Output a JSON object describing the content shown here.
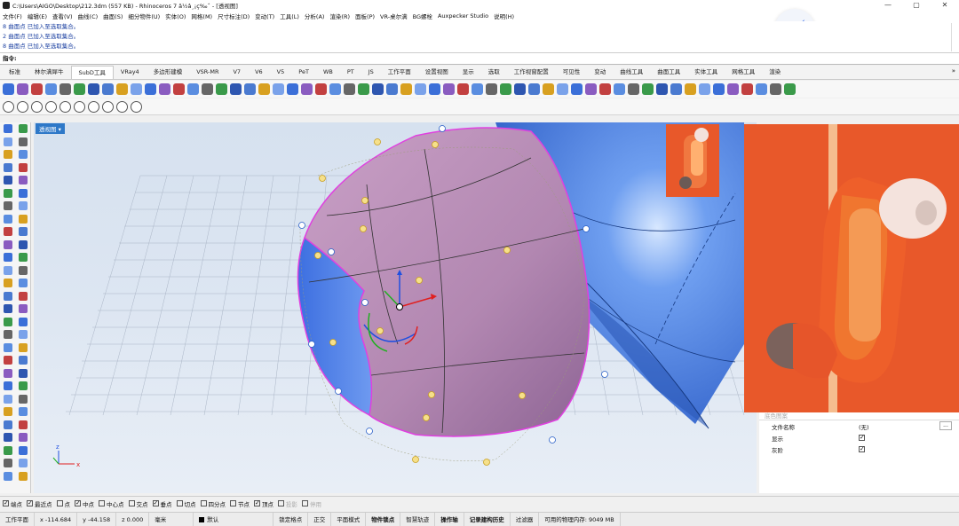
{
  "window": {
    "title": "C:\\Users\\AIGO\\Desktop\\212.3dm (557 KB) - Rhinoceros 7 â½â¸¡ç‰ˆ - [透视图]",
    "controls": [
      "—",
      "▢",
      "✕"
    ]
  },
  "menu": [
    "文件(F)",
    "编辑(E)",
    "查看(V)",
    "曲线(C)",
    "曲面(S)",
    "细分物件(U)",
    "实体(O)",
    "网格(M)",
    "尺寸标注(D)",
    "变动(T)",
    "工具(L)",
    "分析(A)",
    "渲染(R)",
    "面板(P)",
    "VR-桌尔满",
    "BG螺栓",
    "Auxpecker Studio",
    "说明(H)"
  ],
  "command_history": [
    "8 曲面点 已加入至选取集合。",
    "2 曲面点 已加入至选取集合。",
    "8 曲面点 已加入至选取集合。"
  ],
  "command_prompt": "指令:",
  "tabs": [
    "标准",
    "林尔满犀牛",
    "SubD工具",
    "VRay4",
    "多边形建模",
    "VSR-MR",
    "V7",
    "V6",
    "V5",
    "PeT",
    "WB",
    "PT",
    "JS",
    "工作平面",
    "设置视图",
    "显示",
    "选取",
    "工作视窗配置",
    "可见性",
    "变动",
    "曲线工具",
    "曲面工具",
    "实体工具",
    "网格工具",
    "渲染"
  ],
  "active_tab": "SubD工具",
  "viewport": {
    "label": "透视图",
    "axes": {
      "z": "z",
      "x": "x",
      "y": "y"
    }
  },
  "properties": {
    "rows": [
      {
        "label": "文件名称",
        "value": "(无)",
        "type": "text"
      },
      {
        "label": "显示",
        "value": "",
        "type": "check",
        "checked": true
      },
      {
        "label": "灰阶",
        "value": "",
        "type": "check",
        "checked": true
      }
    ],
    "more_button": "..."
  },
  "osnaps": [
    {
      "label": "端点",
      "checked": true
    },
    {
      "label": "最近点",
      "checked": true
    },
    {
      "label": "点",
      "checked": false
    },
    {
      "label": "中点",
      "checked": true
    },
    {
      "label": "中心点",
      "checked": false
    },
    {
      "label": "交点",
      "checked": false
    },
    {
      "label": "垂点",
      "checked": true
    },
    {
      "label": "切点",
      "checked": false
    },
    {
      "label": "四分点",
      "checked": false
    },
    {
      "label": "节点",
      "checked": false
    },
    {
      "label": "顶点",
      "checked": true
    },
    {
      "label": "投影",
      "checked": false,
      "dim": true
    },
    {
      "label": "停用",
      "checked": false,
      "dim": true
    }
  ],
  "status": {
    "cplane": "工作平面",
    "x": "x -114.684",
    "y": "y -44.158",
    "z": "z 0.000",
    "units": "毫米",
    "layer": "默认",
    "toggles": [
      "锁定格点",
      "正交",
      "平面模式",
      "物件锁点",
      "智慧轨迹",
      "操作轴",
      "记录建构历史",
      "过滤器"
    ],
    "memory": "可用的物理内存: 9049 MB"
  },
  "colors": {
    "selection": "#e040e0",
    "surface": "#b98fb6",
    "background_object": "#5a8de0",
    "photo_orange": "#e8582a"
  }
}
